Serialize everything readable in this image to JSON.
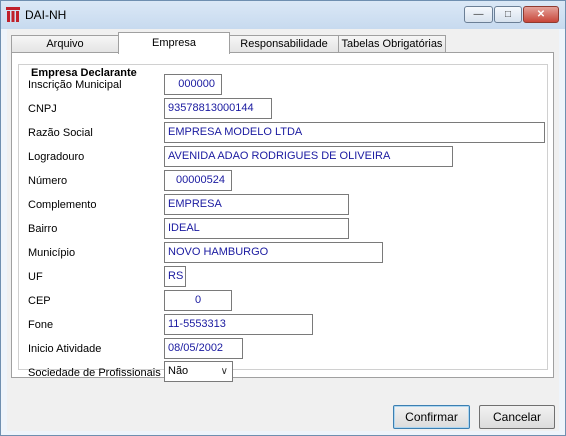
{
  "window": {
    "title": "DAI-NH"
  },
  "title_controls": {
    "minimize": "—",
    "maximize": "□",
    "close": "✕"
  },
  "tabs": [
    {
      "label": "Arquivo",
      "active": false
    },
    {
      "label": "Empresa",
      "active": true
    },
    {
      "label": "Responsabilidade",
      "active": false
    },
    {
      "label": "Tabelas Obrigatórias",
      "active": false
    }
  ],
  "group": {
    "title": "Empresa Declarante"
  },
  "fields": {
    "inscricao": {
      "label": "Inscrição Municipal",
      "value": "000000"
    },
    "cnpj": {
      "label": "CNPJ",
      "value": "93578813000144"
    },
    "razao": {
      "label": "Razão Social",
      "value": "EMPRESA MODELO LTDA"
    },
    "logradouro": {
      "label": "Logradouro",
      "value": "AVENIDA ADAO RODRIGUES DE OLIVEIRA"
    },
    "numero": {
      "label": "Número",
      "value": "00000524"
    },
    "complemento": {
      "label": "Complemento",
      "value": "EMPRESA"
    },
    "bairro": {
      "label": "Bairro",
      "value": "IDEAL"
    },
    "municipio": {
      "label": "Município",
      "value": "NOVO HAMBURGO"
    },
    "uf": {
      "label": "UF",
      "value": "RS"
    },
    "cep": {
      "label": "CEP",
      "value": "0"
    },
    "fone": {
      "label": "Fone",
      "value": "11-5553313"
    },
    "inicio": {
      "label": "Inicio Atividade",
      "value": "08/05/2002"
    },
    "sociedade": {
      "label": "Sociedade de Profissionais",
      "value": "Não"
    }
  },
  "buttons": {
    "confirm": "Confirmar",
    "cancel": "Cancelar"
  },
  "colors": {
    "field_text": "#1a1aa0",
    "close_button": "#c8463a",
    "app_icon": "#c0202a"
  }
}
